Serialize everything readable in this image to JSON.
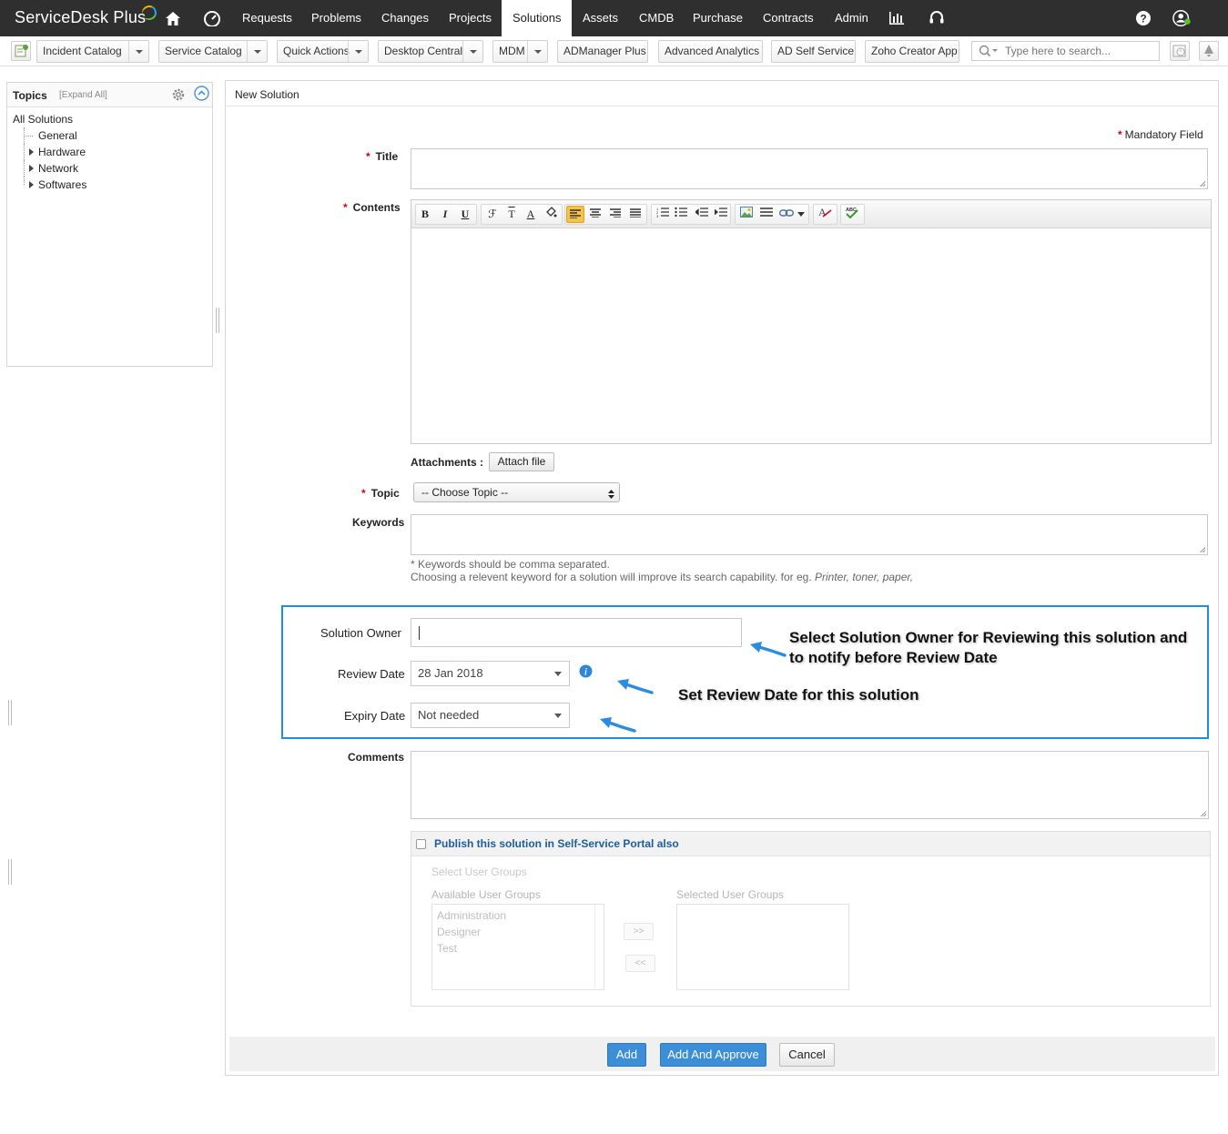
{
  "app": {
    "name": "ServiceDesk Plus"
  },
  "nav": {
    "items": [
      {
        "label": "Requests"
      },
      {
        "label": "Problems"
      },
      {
        "label": "Changes"
      },
      {
        "label": "Projects"
      },
      {
        "label": "Solutions",
        "active": true
      },
      {
        "label": "Assets"
      },
      {
        "label": "CMDB"
      },
      {
        "label": "Purchase"
      },
      {
        "label": "Contracts"
      },
      {
        "label": "Admin"
      }
    ]
  },
  "toolbar": {
    "incident_catalog": "Incident Catalog",
    "service_catalog": "Service Catalog",
    "quick_actions": "Quick Actions",
    "desktop_central": "Desktop Central",
    "mdm": "MDM",
    "admanager": "ADManager Plus",
    "advanced_analytics": "Advanced Analytics",
    "ad_self_service": "AD Self Service",
    "zoho_creator": "Zoho Creator App",
    "search_placeholder": "Type here to search..."
  },
  "topics": {
    "title": "Topics",
    "expand_all": "[Expand All]",
    "root": "All Solutions",
    "children": [
      "General",
      "Hardware",
      "Network",
      "Softwares"
    ]
  },
  "form": {
    "heading": "New Solution",
    "mandatory_label": "Mandatory Field",
    "title_label": "Title",
    "contents_label": "Contents",
    "attachments_label": "Attachments :",
    "attach_button": "Attach file",
    "topic_label": "Topic",
    "topic_value": "-- Choose Topic --",
    "keywords_label": "Keywords",
    "keywords_hint1": "* Keywords should be comma separated.",
    "keywords_hint2": "Choosing a relevent keyword for a solution will improve its search capability. for eg.",
    "keywords_hint_example": "Printer, toner, paper,",
    "owner_label": "Solution Owner",
    "review_label": "Review Date",
    "review_value": "28 Jan 2018",
    "expiry_label": "Expiry Date",
    "expiry_value": "Not needed",
    "comments_label": "Comments",
    "publish_label": "Publish this solution in Self-Service Portal also",
    "select_groups_label": "Select User Groups",
    "available_groups_label": "Available User Groups",
    "selected_groups_label": "Selected User Groups",
    "available_groups": [
      "Administration",
      "Designer",
      "Test"
    ],
    "move_right": ">>",
    "move_left": "<<",
    "add_button": "Add",
    "add_approve_button": "Add And Approve",
    "cancel_button": "Cancel"
  },
  "annotations": {
    "owner_note_line1": "Select Solution Owner for Reviewing this solution and",
    "owner_note_line2": "to notify before Review Date",
    "review_note": "Set Review Date for this solution"
  },
  "colors": {
    "nav_bg": "#2f2f2f",
    "accent_blue": "#1a8fe3",
    "button_blue": "#3c8fd6",
    "required_red": "#d0021b",
    "publish_link": "#1a5d9c"
  }
}
